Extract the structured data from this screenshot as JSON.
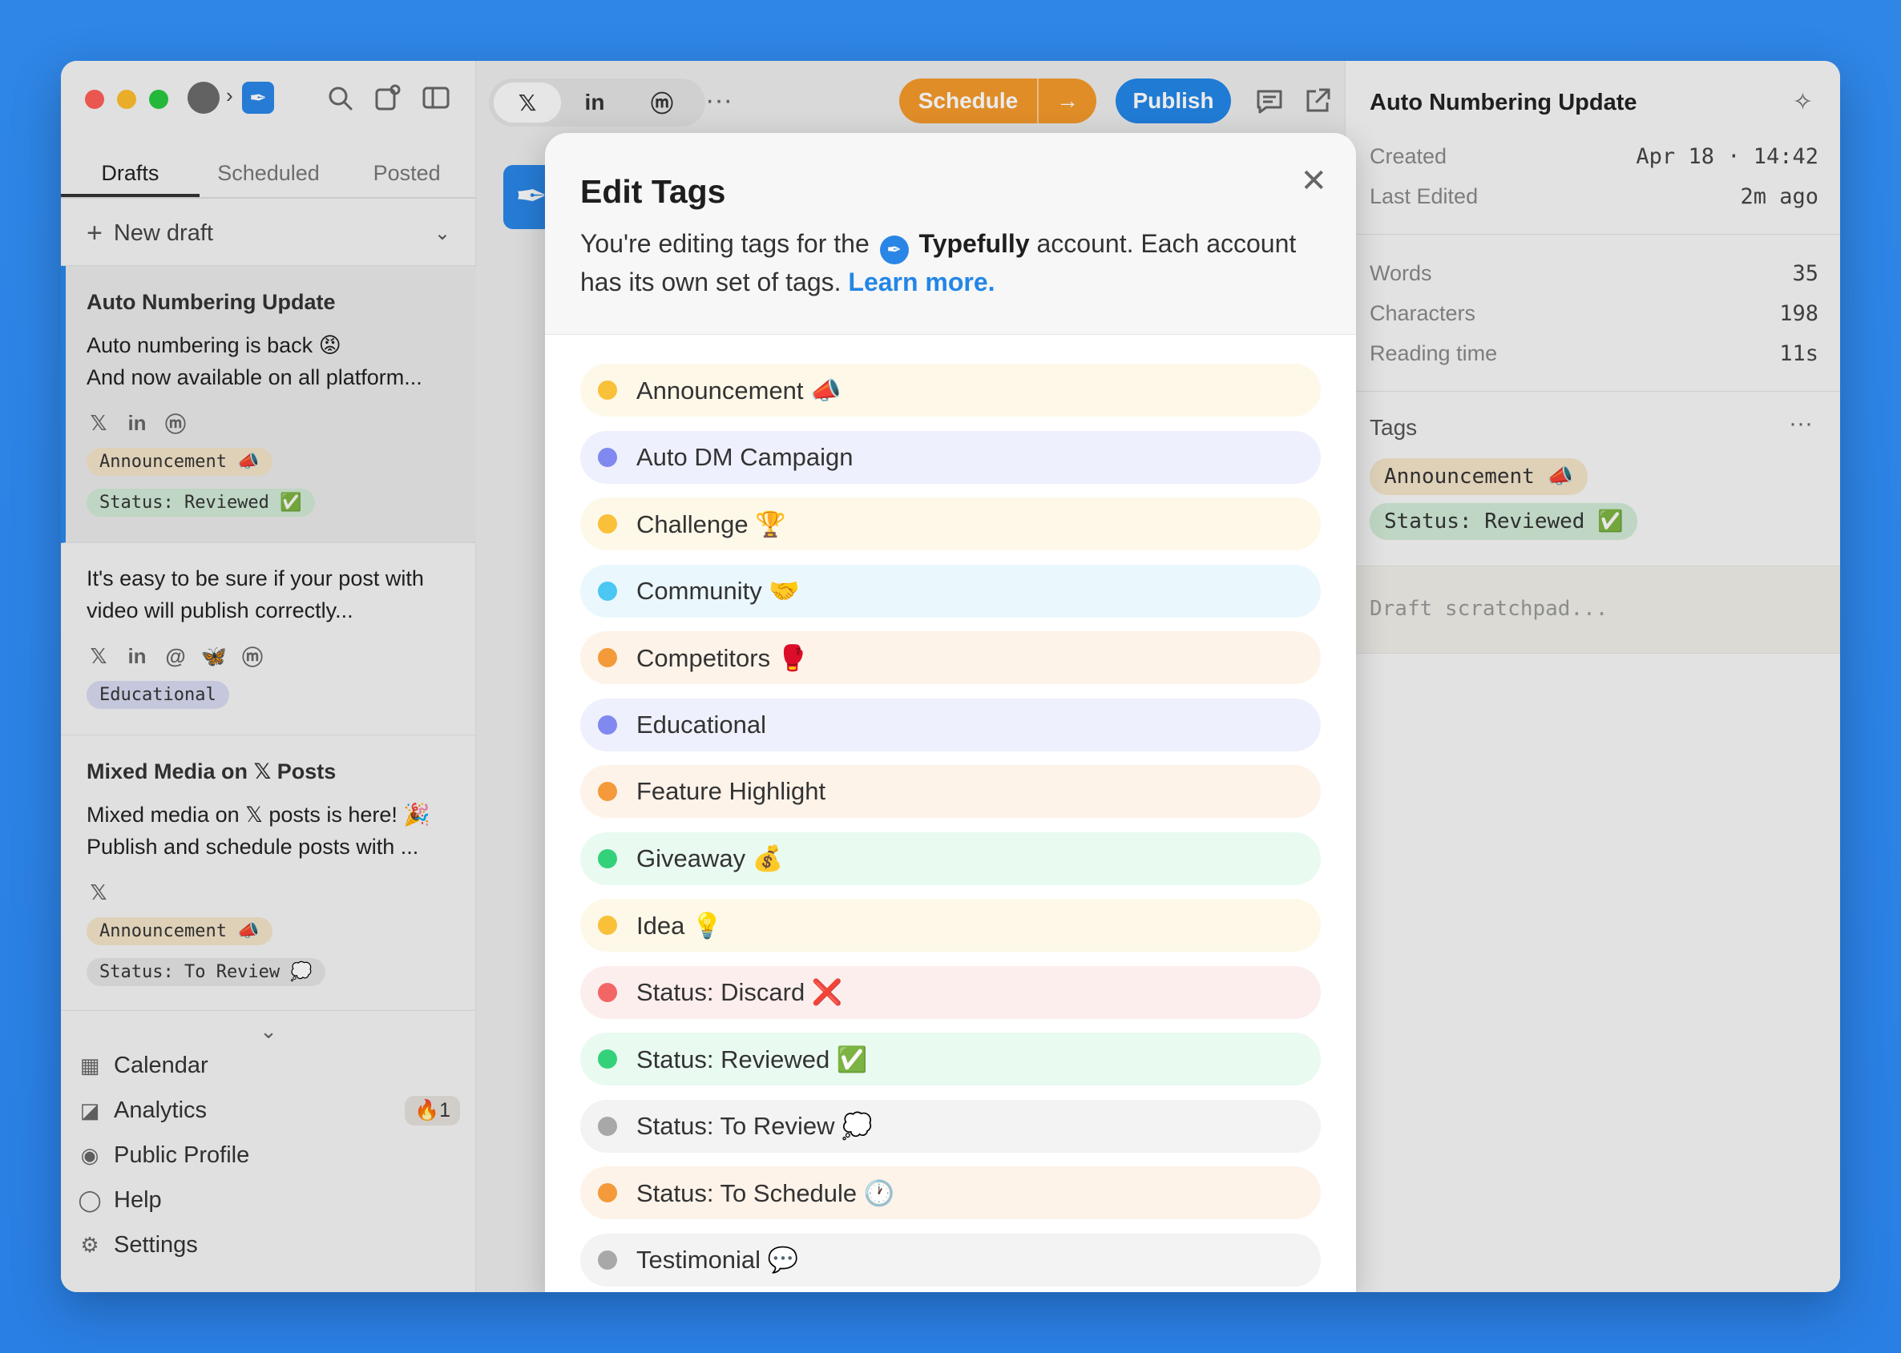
{
  "sidebar": {
    "tabs": [
      "Drafts",
      "Scheduled",
      "Posted"
    ],
    "new_draft": "New draft",
    "drafts": [
      {
        "title": "Auto Numbering Update",
        "body": "Auto numbering is back 😡\nAnd now available on all platform...",
        "platforms": [
          "x-icon",
          "linkedin-icon",
          "mastodon-icon"
        ],
        "tags": [
          "Announcement 📣",
          "Status: Reviewed ✅"
        ]
      },
      {
        "title": "",
        "body": "It's easy to be sure if your post with\nvideo will publish correctly...",
        "platforms": [
          "x-icon",
          "linkedin-icon",
          "threads-icon",
          "bluesky-icon",
          "mastodon-icon"
        ],
        "tags": [
          "Educational"
        ]
      },
      {
        "title": "Mixed Media on 𝕏 Posts",
        "body": "Mixed media on 𝕏 posts is here! 🎉\nPublish and schedule posts with ...",
        "platforms": [
          "x-icon"
        ],
        "tags": [
          "Announcement 📣",
          "Status: To Review 💭"
        ]
      }
    ],
    "nav": [
      {
        "label": "Calendar",
        "icon": "calendar-icon"
      },
      {
        "label": "Analytics",
        "icon": "analytics-icon",
        "badge": "🔥1"
      },
      {
        "label": "Public Profile",
        "icon": "profile-icon"
      },
      {
        "label": "Help",
        "icon": "help-icon"
      },
      {
        "label": "Settings",
        "icon": "settings-icon"
      }
    ]
  },
  "toolbar": {
    "schedule_label": "Schedule",
    "publish_label": "Publish"
  },
  "right_panel": {
    "title": "Auto Numbering Update",
    "created_label": "Created",
    "created_value": "Apr 18 · 14:42",
    "edited_label": "Last Edited",
    "edited_value": "2m ago",
    "words_label": "Words",
    "words_value": "35",
    "chars_label": "Characters",
    "chars_value": "198",
    "reading_label": "Reading time",
    "reading_value": "11s",
    "tags_label": "Tags",
    "tags": [
      "Announcement 📣",
      "Status: Reviewed ✅"
    ],
    "scratchpad_placeholder": "Draft scratchpad..."
  },
  "modal": {
    "title": "Edit Tags",
    "desc_before": "You're editing tags for the",
    "account_name": "Typefully",
    "desc_after": "account. Each account has its own set of tags.",
    "learn_more": "Learn more.",
    "tags": [
      {
        "label": "Announcement 📣",
        "dot": "#f9c03a",
        "bg": "#fef8e8"
      },
      {
        "label": "Auto DM Campaign",
        "dot": "#7f89ef",
        "bg": "#eef0fd"
      },
      {
        "label": "Challenge 🏆",
        "dot": "#f9c03a",
        "bg": "#fef8e8"
      },
      {
        "label": "Community 🤝",
        "dot": "#4cc6f3",
        "bg": "#eaf8fe"
      },
      {
        "label": "Competitors 🥊",
        "dot": "#f49a3a",
        "bg": "#fef3e9"
      },
      {
        "label": "Educational",
        "dot": "#7f89ef",
        "bg": "#eef0fd"
      },
      {
        "label": "Feature Highlight",
        "dot": "#f49a3a",
        "bg": "#fef3e9"
      },
      {
        "label": "Giveaway 💰",
        "dot": "#33d17a",
        "bg": "#e9faf1"
      },
      {
        "label": "Idea 💡",
        "dot": "#f9c03a",
        "bg": "#fef8e8"
      },
      {
        "label": "Status: Discard ❌",
        "dot": "#f26666",
        "bg": "#fdeeee"
      },
      {
        "label": "Status: Reviewed ✅",
        "dot": "#33d17a",
        "bg": "#e9faf1"
      },
      {
        "label": "Status: To Review 💭",
        "dot": "#a8a8a8",
        "bg": "#f3f3f3"
      },
      {
        "label": "Status: To Schedule 🕐",
        "dot": "#f49a3a",
        "bg": "#fef3e9"
      },
      {
        "label": "Testimonial 💬",
        "dot": "#a8a8a8",
        "bg": "#f3f3f3"
      }
    ]
  }
}
